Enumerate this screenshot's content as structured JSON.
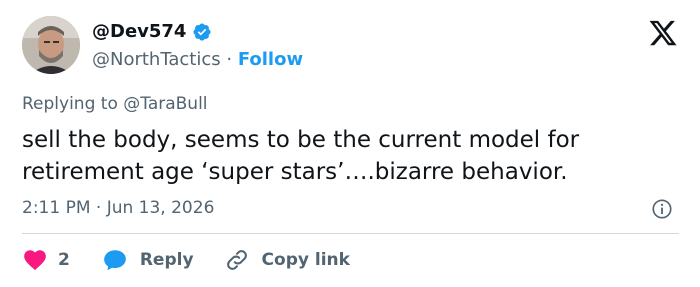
{
  "author": {
    "display_name": "@Dev574",
    "handle": "@NorthTactics",
    "separator": "·",
    "follow_label": "Follow",
    "avatar": "profile-photo-man-beard"
  },
  "brand_logo": "x-logo-icon",
  "reply_context": {
    "prefix": "Replying to",
    "target": "@TaraBull"
  },
  "tweet": {
    "text": "sell the body, seems to be the current model for retirement age ‘super stars’….bizarre behavior.",
    "timestamp": "2:11 PM · Jun 13, 2026"
  },
  "actions": {
    "like_count": "2",
    "reply_label": "Reply",
    "copy_label": "Copy link"
  },
  "colors": {
    "accent": "#1d9bf0",
    "like": "#f91880",
    "muted": "#536471",
    "text": "#0f1419"
  }
}
